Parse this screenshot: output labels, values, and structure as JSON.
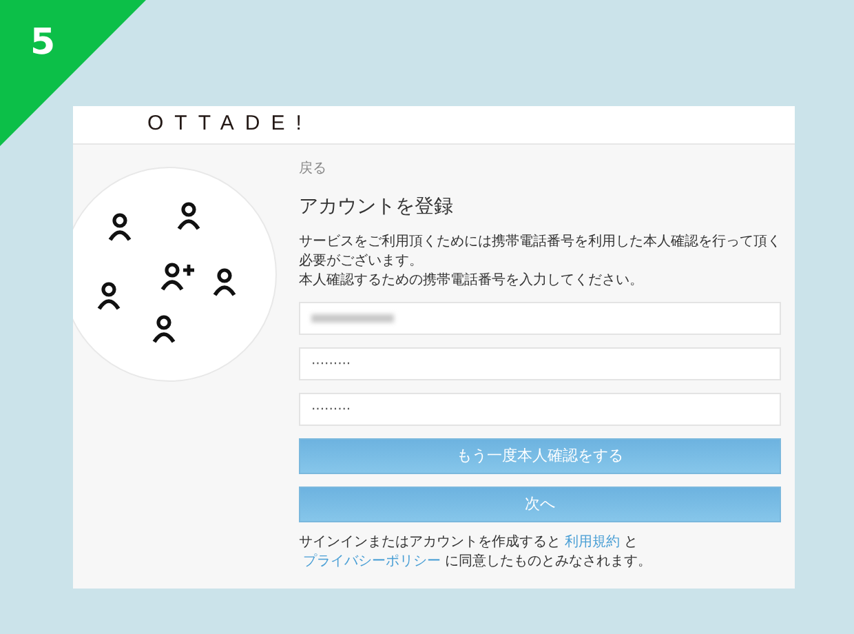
{
  "badge": "5",
  "logo": "OTTADE!",
  "back_link": "戻る",
  "title": "アカウントを登録",
  "description": [
    "サービスをご利用頂くためには携帯電話番号を利用した本人確認を行って頂く必要がございます。",
    "本人確認するための携帯電話番号を入力してください。"
  ],
  "fields": [
    {
      "kind": "redacted"
    },
    {
      "kind": "password",
      "value": "·········"
    },
    {
      "kind": "password",
      "value": "·········"
    }
  ],
  "buttons": [
    "もう一度本人確認をする",
    "次へ"
  ],
  "terms": [
    {
      "kind": "text",
      "text": "サインインまたはアカウントを作成すると"
    },
    {
      "kind": "link",
      "text": "利用規約"
    },
    {
      "kind": "text",
      "text": "と"
    },
    {
      "kind": "link",
      "text": "プライバシーポリシー"
    },
    {
      "kind": "text",
      "text": "に同意したものとみなされます。"
    }
  ]
}
